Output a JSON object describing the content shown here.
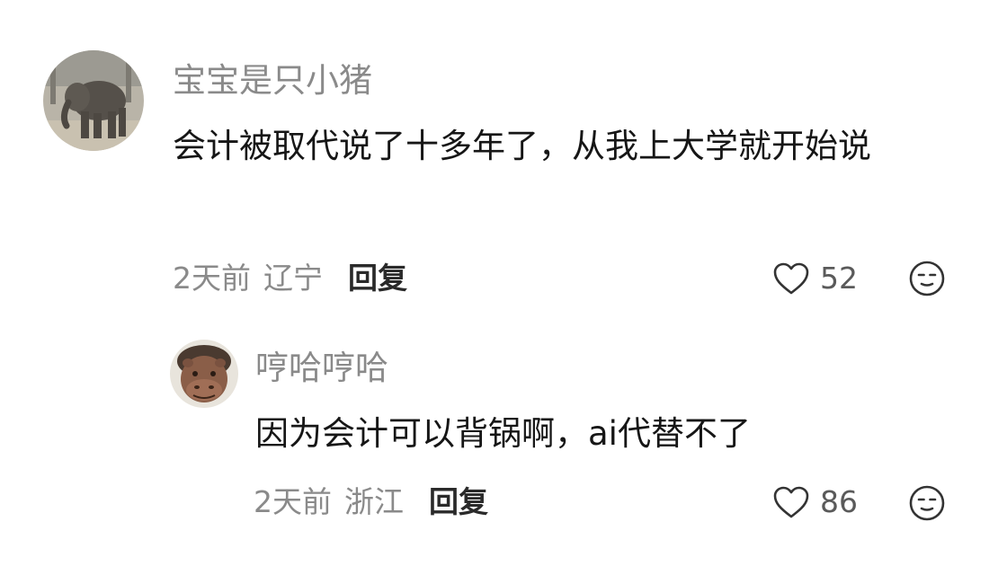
{
  "comments": [
    {
      "username": "宝宝是只小猪",
      "avatar_icon": "elephant-avatar",
      "content": "会计被取代说了十多年了，从我上大学就开始说",
      "time": "2天前",
      "location": "辽宁",
      "reply_label": "回复",
      "like_count": "52",
      "like_icon": "heart-outline-icon",
      "dislike_icon": "neutral-face-icon"
    },
    {
      "username": "哼哈哼哈",
      "avatar_icon": "hippo-avatar",
      "content": "因为会计可以背锅啊，ai代替不了",
      "time": "2天前",
      "location": "浙江",
      "reply_label": "回复",
      "like_count": "86",
      "like_icon": "heart-outline-icon",
      "dislike_icon": "neutral-face-icon"
    }
  ],
  "colors": {
    "secondary_text": "#8a8a8a",
    "primary_text": "#161616",
    "reply_text": "#2a2a2a",
    "icon_stroke": "#333333"
  }
}
